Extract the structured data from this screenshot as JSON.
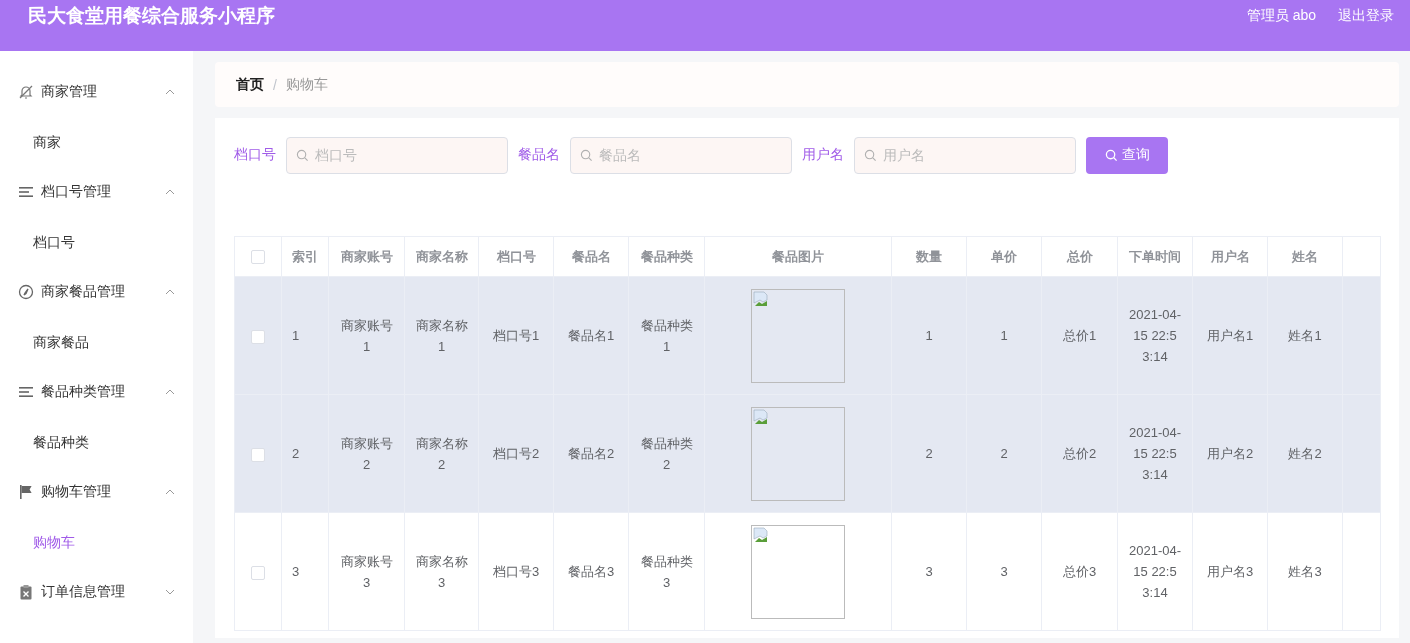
{
  "header": {
    "title": "民大食堂用餐综合服务小程序",
    "user": "管理员 abo",
    "logout": "退出登录"
  },
  "sidebar": {
    "groups": [
      {
        "label": "商家管理",
        "kind": "bell",
        "expanded": true,
        "children": [
          {
            "label": "商家",
            "selected": false
          }
        ]
      },
      {
        "label": "档口号管理",
        "kind": "lines",
        "expanded": true,
        "children": [
          {
            "label": "档口号",
            "selected": false
          }
        ]
      },
      {
        "label": "商家餐品管理",
        "kind": "compass",
        "expanded": true,
        "children": [
          {
            "label": "商家餐品",
            "selected": false
          }
        ]
      },
      {
        "label": "餐品种类管理",
        "kind": "lines",
        "expanded": true,
        "children": [
          {
            "label": "餐品种类",
            "selected": false
          }
        ]
      },
      {
        "label": "购物车管理",
        "kind": "flag",
        "expanded": true,
        "children": [
          {
            "label": "购物车",
            "selected": true
          }
        ]
      },
      {
        "label": "订单信息管理",
        "kind": "clipboard",
        "expanded": false
      }
    ]
  },
  "breadcrumb": {
    "separator": "/",
    "items": [
      {
        "label": "首页",
        "current": false
      },
      {
        "label": "购物车",
        "current": true
      }
    ]
  },
  "search": {
    "fields": [
      {
        "label": "档口号",
        "placeholder": "档口号"
      },
      {
        "label": "餐品名",
        "placeholder": "餐品名"
      },
      {
        "label": "用户名",
        "placeholder": "用户名"
      }
    ],
    "button": "查询"
  },
  "table": {
    "select_all_checked": false,
    "columns": [
      "索引",
      "商家账号",
      "商家名称",
      "档口号",
      "餐品名",
      "餐品种类",
      "餐品图片",
      "数量",
      "单价",
      "总价",
      "下单时间",
      "用户名",
      "姓名"
    ],
    "rows": [
      {
        "checked": false,
        "highlighted": true,
        "cells": [
          {
            "kind": "text",
            "text": "1"
          },
          {
            "kind": "text",
            "text": "商家账号1"
          },
          {
            "kind": "text",
            "text": "商家名称1"
          },
          {
            "kind": "text",
            "text": "档口号1"
          },
          {
            "kind": "text",
            "text": "餐品名1"
          },
          {
            "kind": "text",
            "text": "餐品种类1"
          },
          {
            "kind": "image"
          },
          {
            "kind": "text",
            "text": "1"
          },
          {
            "kind": "text",
            "text": "1"
          },
          {
            "kind": "text",
            "text": "总价1"
          },
          {
            "kind": "text",
            "text": "2021-04-15 22:53:14"
          },
          {
            "kind": "text",
            "text": "用户名1"
          },
          {
            "kind": "text",
            "text": "姓名1"
          }
        ]
      },
      {
        "checked": false,
        "highlighted": true,
        "cells": [
          {
            "kind": "text",
            "text": "2"
          },
          {
            "kind": "text",
            "text": "商家账号2"
          },
          {
            "kind": "text",
            "text": "商家名称2"
          },
          {
            "kind": "text",
            "text": "档口号2"
          },
          {
            "kind": "text",
            "text": "餐品名2"
          },
          {
            "kind": "text",
            "text": "餐品种类2"
          },
          {
            "kind": "image"
          },
          {
            "kind": "text",
            "text": "2"
          },
          {
            "kind": "text",
            "text": "2"
          },
          {
            "kind": "text",
            "text": "总价2"
          },
          {
            "kind": "text",
            "text": "2021-04-15 22:53:14"
          },
          {
            "kind": "text",
            "text": "用户名2"
          },
          {
            "kind": "text",
            "text": "姓名2"
          }
        ]
      },
      {
        "checked": false,
        "highlighted": false,
        "cells": [
          {
            "kind": "text",
            "text": "3"
          },
          {
            "kind": "text",
            "text": "商家账号3"
          },
          {
            "kind": "text",
            "text": "商家名称3"
          },
          {
            "kind": "text",
            "text": "档口号3"
          },
          {
            "kind": "text",
            "text": "餐品名3"
          },
          {
            "kind": "text",
            "text": "餐品种类3"
          },
          {
            "kind": "image"
          },
          {
            "kind": "text",
            "text": "3"
          },
          {
            "kind": "text",
            "text": "3"
          },
          {
            "kind": "text",
            "text": "总价3"
          },
          {
            "kind": "text",
            "text": "2021-04-15 22:53:14"
          },
          {
            "kind": "text",
            "text": "用户名3"
          },
          {
            "kind": "text",
            "text": "姓名3"
          }
        ]
      }
    ]
  }
}
